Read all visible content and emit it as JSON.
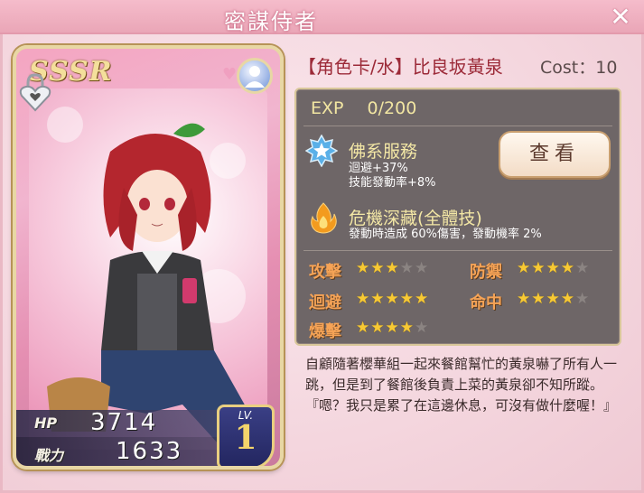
{
  "window": {
    "title": "密謀侍者",
    "close_label": "✕"
  },
  "card": {
    "rarity": "SSSR",
    "hp_label": "HP",
    "hp_value": "3714",
    "power_label": "戰力",
    "power_value": "1633",
    "lv_label": "LV.",
    "lv_value": "1",
    "icons": [
      "lock-heart-icon",
      "heart-icon",
      "user-icon"
    ]
  },
  "header": {
    "name": "【角色卡/水】比良坂黃泉",
    "cost": "Cost：10"
  },
  "info": {
    "exp_label": "EXP",
    "exp_value": "0/200",
    "view_button": "查看",
    "skills": [
      {
        "name": "佛系服務",
        "lines": [
          "迴避+37%",
          "技能發動率+8%"
        ],
        "icon": "star-badge-icon"
      },
      {
        "name": "危機深藏(全體技)",
        "lines": [
          "發動時造成 60%傷害，發動機率 2%"
        ],
        "icon": "flame-icon"
      }
    ],
    "attributes": [
      {
        "label": "攻擊",
        "stars": 3,
        "max": 5
      },
      {
        "label": "防禦",
        "stars": 4,
        "max": 5
      },
      {
        "label": "迴避",
        "stars": 5,
        "max": 5
      },
      {
        "label": "命中",
        "stars": 4,
        "max": 5
      },
      {
        "label": "爆擊",
        "stars": 4,
        "max": 5
      }
    ]
  },
  "description": "自顧隨著櫻華組一起來餐館幫忙的黃泉嚇了所有人一跳，但是到了餐館後負責上菜的黃泉卻不知所蹤。『嗯？我只是累了在這邊休息，可沒有做什麼喔！』",
  "colors": {
    "accent": "#9c2a38",
    "star": "#f7c934",
    "panel": "#6e6667"
  }
}
